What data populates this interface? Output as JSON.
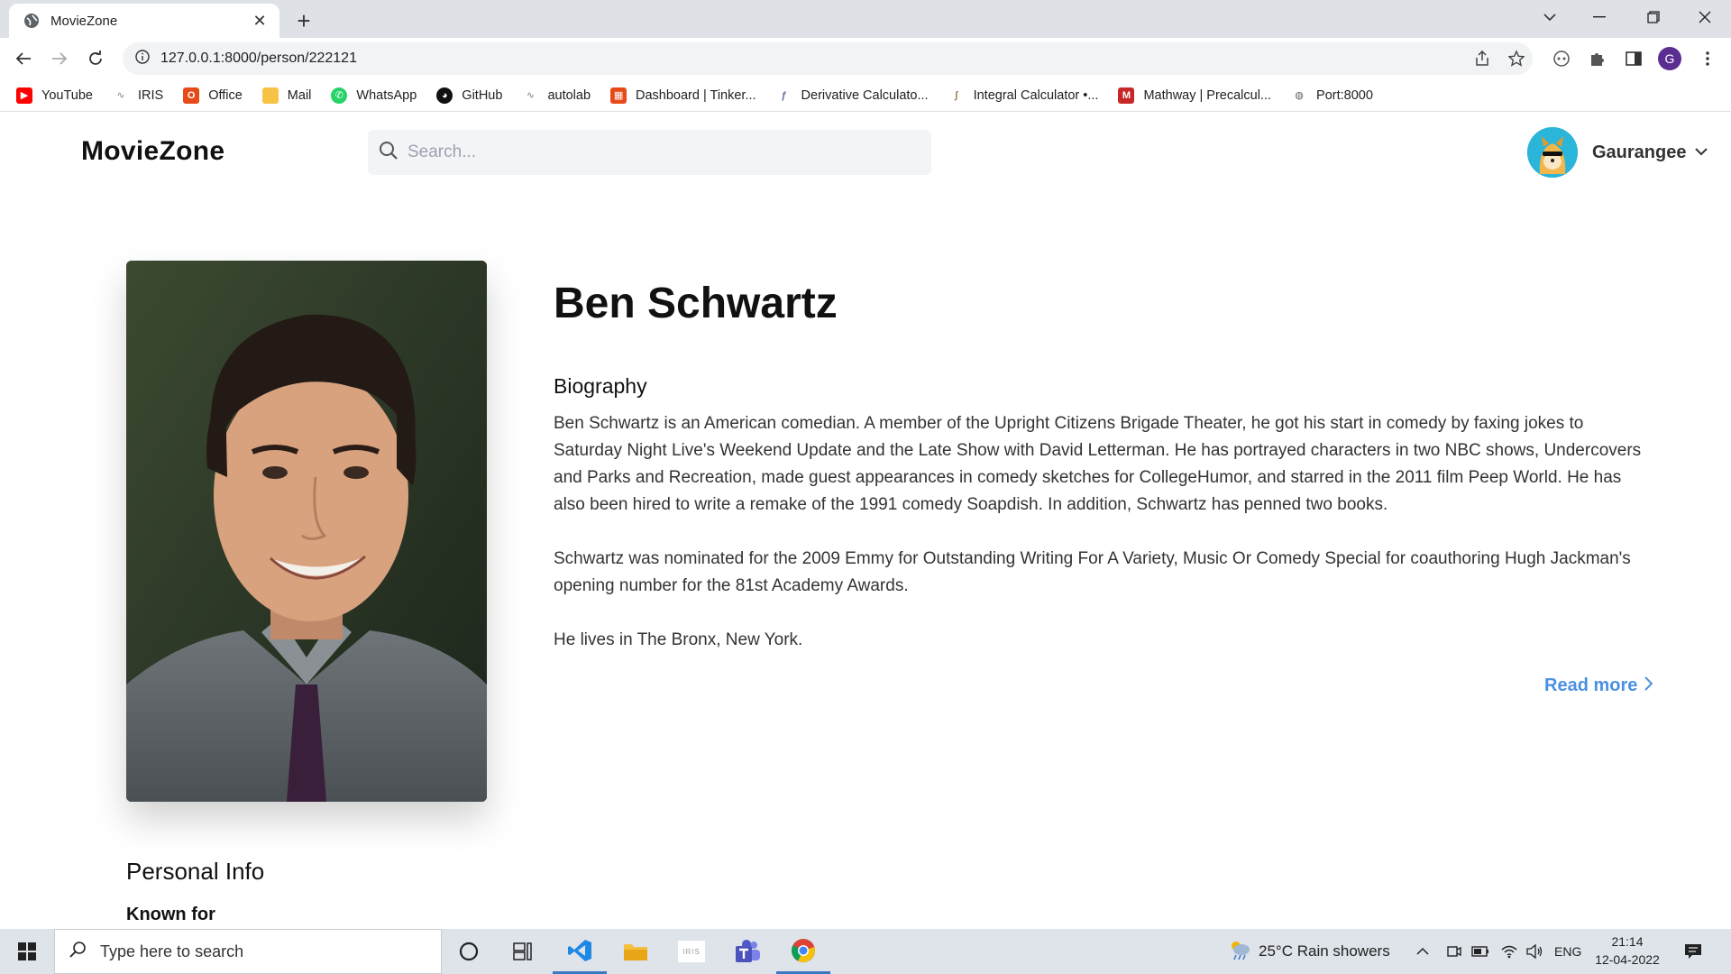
{
  "browser": {
    "tab_title": "MovieZone",
    "tab_close": "✕",
    "new_tab": "+",
    "url": "127.0.0.1:8000/person/222121",
    "profile_initial": "G",
    "bookmarks": [
      {
        "label": "YouTube",
        "icon": "youtube-icon",
        "color": "#ff0000"
      },
      {
        "label": "IRIS",
        "icon": "iris-icon",
        "color": "#9aa0a6"
      },
      {
        "label": "Office",
        "icon": "office-icon",
        "color": "#e64a19"
      },
      {
        "label": "Mail",
        "icon": "folder-icon",
        "color": "#f6c344"
      },
      {
        "label": "WhatsApp",
        "icon": "whatsapp-icon",
        "color": "#25d366"
      },
      {
        "label": "GitHub",
        "icon": "github-icon",
        "color": "#111111"
      },
      {
        "label": "autolab",
        "icon": "iris-icon",
        "color": "#9aa0a6"
      },
      {
        "label": "Dashboard | Tinker...",
        "icon": "tinkercad-icon",
        "color": "#e64a19"
      },
      {
        "label": "Derivative Calculato...",
        "icon": "derivative-icon",
        "color": "#5b6e9c"
      },
      {
        "label": "Integral Calculator •...",
        "icon": "integral-icon",
        "color": "#a0804a"
      },
      {
        "label": "Mathway | Precalcul...",
        "icon": "mathway-icon",
        "color": "#c62828"
      },
      {
        "label": "Port:8000",
        "icon": "globe-icon",
        "color": "#5f6368"
      }
    ]
  },
  "site": {
    "brand": "MovieZone",
    "search_placeholder": "Search...",
    "username": "Gaurangee"
  },
  "person": {
    "name": "Ben Schwartz",
    "biography_heading": "Biography",
    "biography": [
      "Ben Schwartz is an American comedian. A member of the Upright Citizens Brigade Theater, he got his start in comedy by faxing jokes to Saturday Night Live's Weekend Update and the Late Show with David Letterman. He has portrayed characters in two NBC shows, Undercovers and Parks and Recreation, made guest appearances in comedy sketches for CollegeHumor, and starred in the 2011 film Peep World. He has also been hired to write a remake of the 1991 comedy Soapdish. In addition, Schwartz has penned two books.",
      "Schwartz was nominated for the 2009 Emmy for Outstanding Writing For A Variety, Music Or Comedy Special for coauthoring Hugh Jackman's opening number for the 81st Academy Awards.",
      "He lives in The Bronx, New York."
    ],
    "read_more": "Read more",
    "personal_info_heading": "Personal Info",
    "known_for_label": "Known for"
  },
  "taskbar": {
    "search_placeholder": "Type here to search",
    "weather": "25°C  Rain showers",
    "language": "ENG",
    "time": "21:14",
    "date": "12-04-2022"
  }
}
